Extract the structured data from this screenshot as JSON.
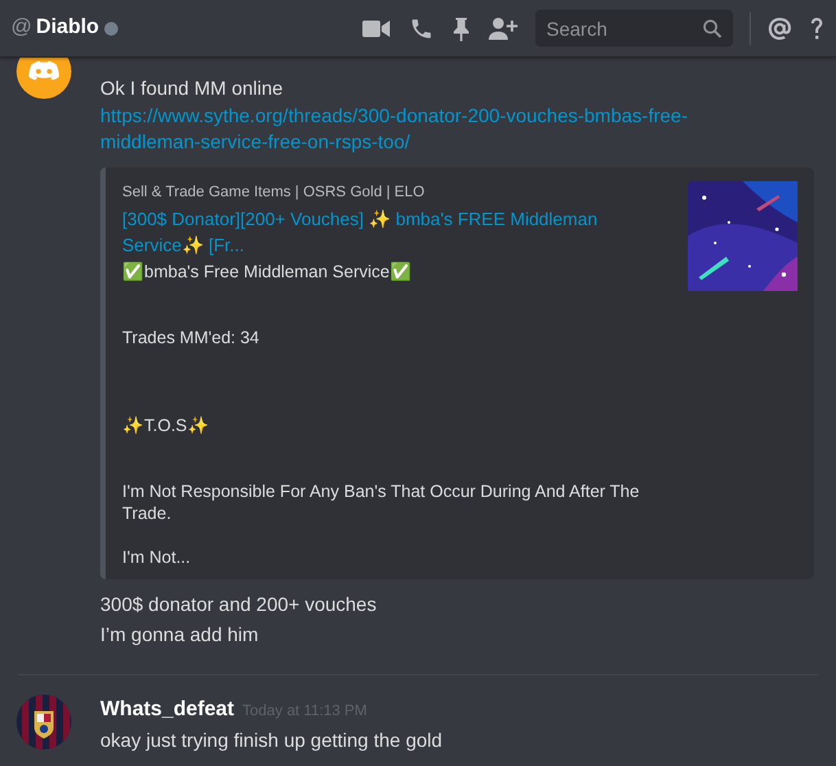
{
  "header": {
    "prefix": "@",
    "title": "Diablo",
    "online": false
  },
  "search": {
    "placeholder": "Search"
  },
  "messages": [
    {
      "avatar": {
        "kind": "discord"
      },
      "lines": [
        "Ok I found MM online"
      ],
      "link": "https://www.sythe.org/threads/300-donator-200-vouches-bmbas-free-middleman-service-free-on-rsps-too/",
      "embed": {
        "provider": "Sell & Trade Game Items | OSRS Gold | ELO",
        "title": "[300$ Donator][200+ Vouches] ✨ bmba's FREE Middleman Service✨ [Fr...",
        "description": "✅bmba's Free Middleman Service✅\n\n\nTrades MM'ed: 34\n\n\n\n✨T.O.S✨\n\n\nI'm Not Responsible For Any Ban's That Occur During And After The Trade.\n\nI'm Not..."
      },
      "after_lines": [
        "300$ donator and 200+ vouches",
        "I’m gonna add him"
      ]
    },
    {
      "avatar": {
        "kind": "crest"
      },
      "author": "Whats_defeat",
      "time": "Today at 11:13 PM",
      "lines": [
        "okay just trying finish up getting the gold"
      ]
    }
  ]
}
